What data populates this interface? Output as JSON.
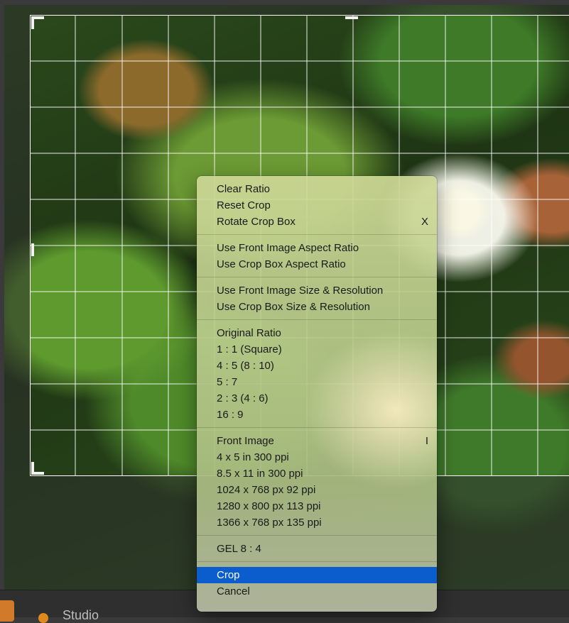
{
  "menu": {
    "groups": [
      {
        "items": [
          {
            "label": "Clear Ratio",
            "shortcut": ""
          },
          {
            "label": "Reset Crop",
            "shortcut": ""
          },
          {
            "label": "Rotate Crop Box",
            "shortcut": "X"
          }
        ]
      },
      {
        "items": [
          {
            "label": "Use Front Image Aspect Ratio",
            "shortcut": ""
          },
          {
            "label": "Use Crop Box Aspect Ratio",
            "shortcut": ""
          }
        ]
      },
      {
        "items": [
          {
            "label": "Use Front Image Size & Resolution",
            "shortcut": ""
          },
          {
            "label": "Use Crop Box Size & Resolution",
            "shortcut": ""
          }
        ]
      },
      {
        "items": [
          {
            "label": "Original Ratio",
            "shortcut": ""
          },
          {
            "label": "1 : 1 (Square)",
            "shortcut": ""
          },
          {
            "label": "4 : 5 (8 : 10)",
            "shortcut": ""
          },
          {
            "label": "5 : 7",
            "shortcut": ""
          },
          {
            "label": "2 : 3 (4 : 6)",
            "shortcut": ""
          },
          {
            "label": "16 : 9",
            "shortcut": ""
          }
        ]
      },
      {
        "items": [
          {
            "label": "Front Image",
            "shortcut": "I"
          },
          {
            "label": "4 x 5 in 300 ppi",
            "shortcut": ""
          },
          {
            "label": "8.5 x 11 in 300 ppi",
            "shortcut": ""
          },
          {
            "label": "1024 x 768 px 92 ppi",
            "shortcut": ""
          },
          {
            "label": "1280 x 800 px 113 ppi",
            "shortcut": ""
          },
          {
            "label": "1366 x 768 px 135 ppi",
            "shortcut": ""
          }
        ]
      },
      {
        "items": [
          {
            "label": "GEL 8 : 4",
            "shortcut": ""
          }
        ]
      },
      {
        "items": [
          {
            "label": "Crop",
            "shortcut": "",
            "highlighted": true
          },
          {
            "label": "Cancel",
            "shortcut": ""
          }
        ]
      }
    ]
  },
  "status_bar": {
    "label": "Studio"
  },
  "colors": {
    "highlight": "#0b5ccc",
    "grid": "#ffffff"
  }
}
